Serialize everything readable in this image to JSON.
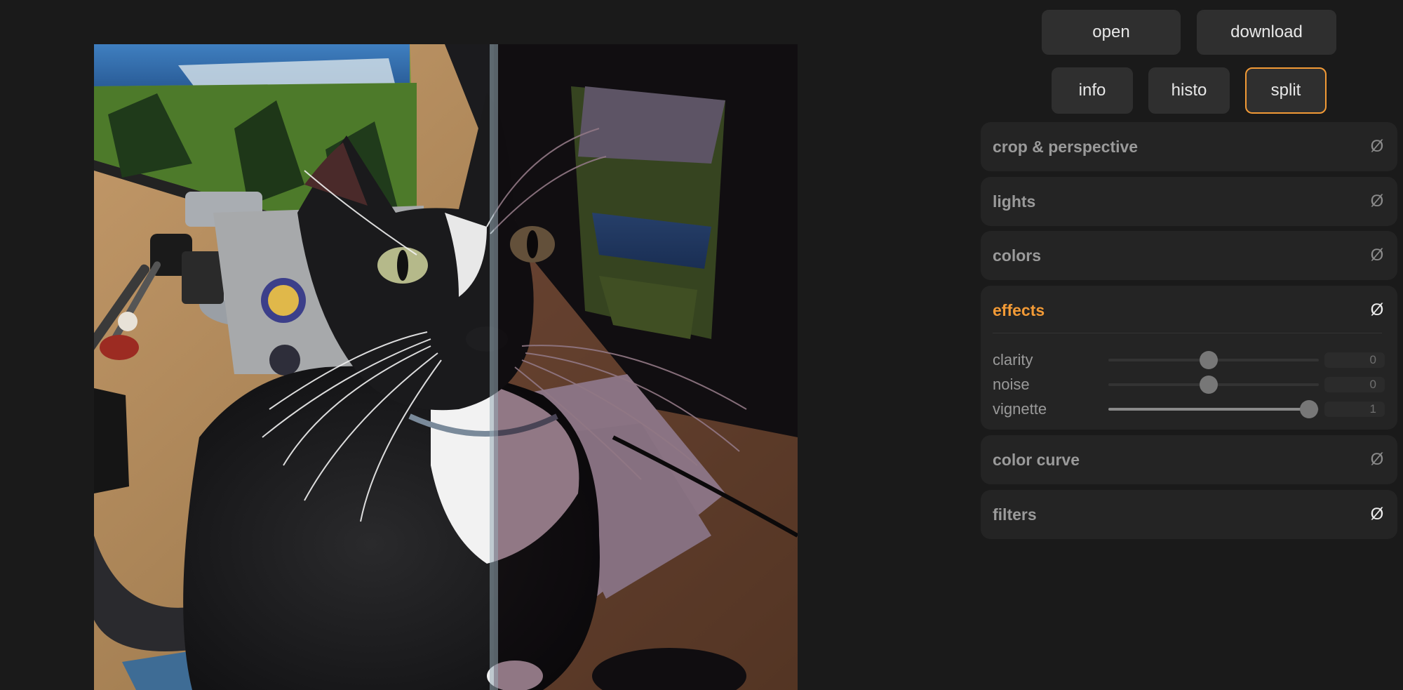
{
  "toolbar": {
    "open_label": "open",
    "download_label": "download",
    "info_label": "info",
    "histo_label": "histo",
    "split_label": "split"
  },
  "accent_color": "#f29a36",
  "reset_symbol": "Ø",
  "panels": {
    "crop": {
      "title": "crop & perspective"
    },
    "lights": {
      "title": "lights"
    },
    "colors": {
      "title": "colors"
    },
    "effects": {
      "title": "effects",
      "controls": {
        "clarity": {
          "label": "clarity",
          "value": "0",
          "position": 0.5
        },
        "noise": {
          "label": "noise",
          "value": "0",
          "position": 0.5
        },
        "vignette": {
          "label": "vignette",
          "value": "1",
          "position": 1.0
        }
      }
    },
    "curve": {
      "title": "color curve"
    },
    "filters": {
      "title": "filters"
    }
  },
  "image": {
    "subject": "tuxedo cat photo",
    "split_view": true
  }
}
